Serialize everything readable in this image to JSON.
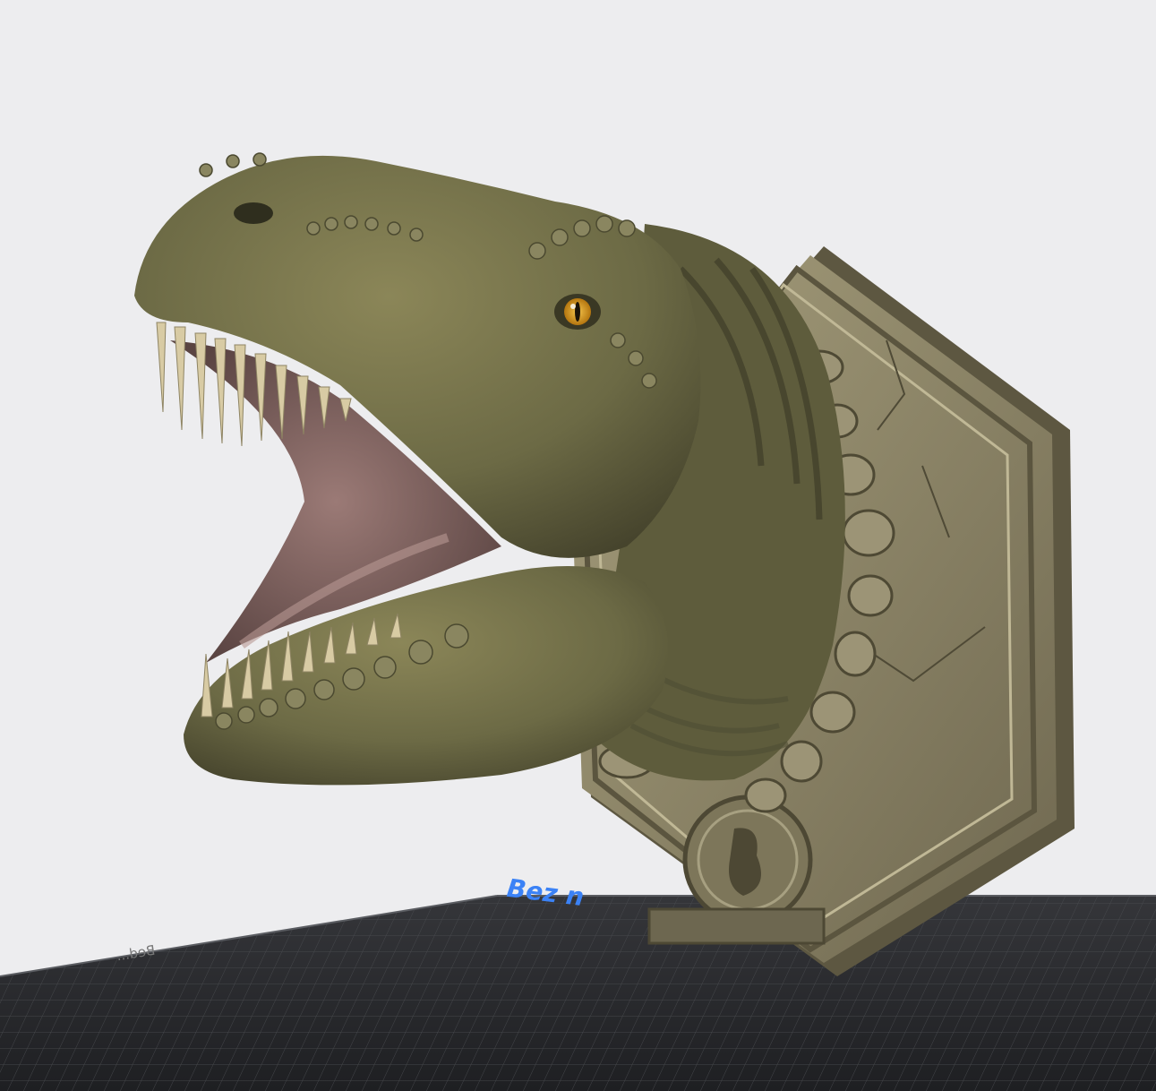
{
  "colors": {
    "background": "#ededef",
    "bed_fill": "#2b2c2f",
    "bed_grid": "#4a4c50",
    "model_skin": "#6c6a45",
    "model_base": "#8f8868",
    "label_accent": "#3b82f6"
  },
  "build_plate": {
    "label": "Bez n",
    "mirrored_label": "Bed..."
  },
  "model": {
    "name": "t-rex-head-wall-mount-icon"
  }
}
